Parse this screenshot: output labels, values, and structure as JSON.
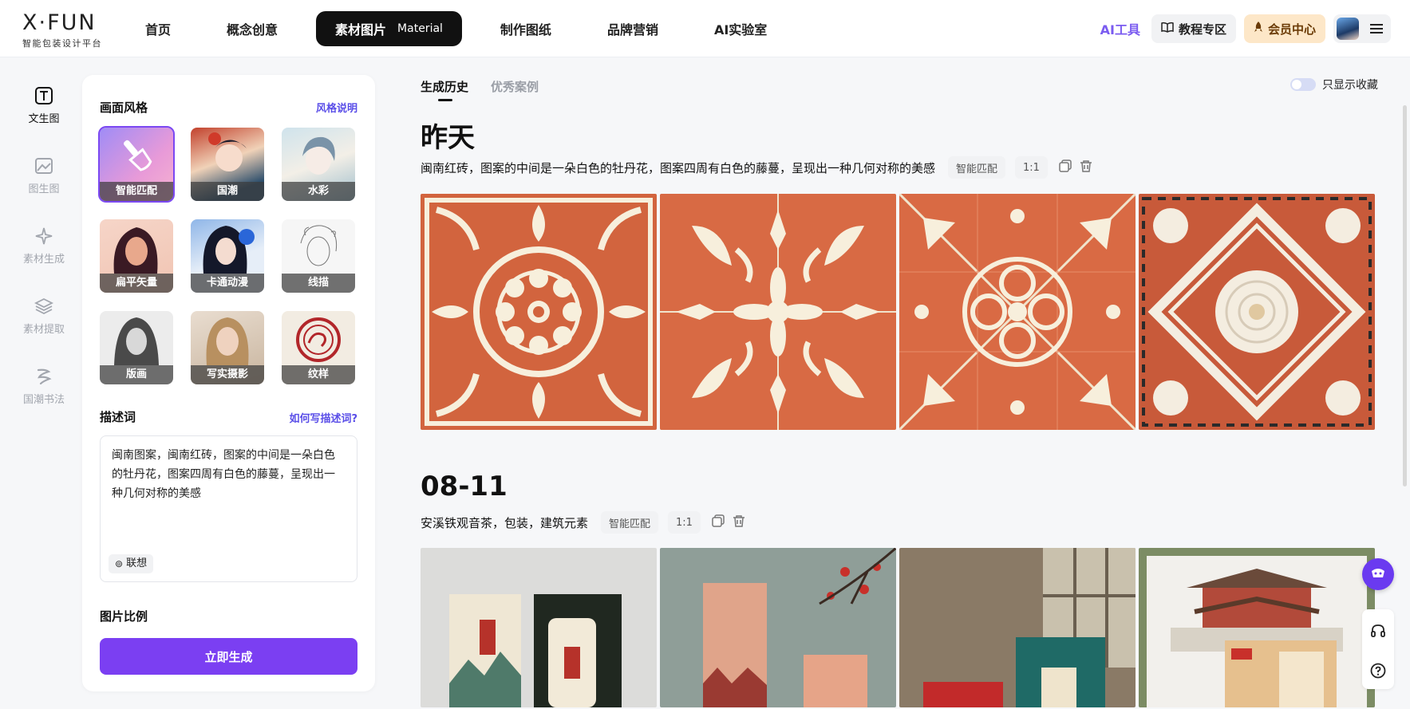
{
  "header": {
    "logo_main": "X·FUN",
    "logo_sub": "智能包装设计平台",
    "nav": [
      {
        "label": "首页"
      },
      {
        "label": "概念创意"
      },
      {
        "label": "素材图片",
        "sub": "Material"
      },
      {
        "label": "制作图纸"
      },
      {
        "label": "品牌营销"
      },
      {
        "label": "AI实验室"
      }
    ],
    "ai_tools": "AI工具",
    "tutorial": "教程专区",
    "vip": "会员中心"
  },
  "rail": [
    {
      "label": "文生图",
      "icon": "text-to-image-icon"
    },
    {
      "label": "图生图",
      "icon": "image-to-image-icon"
    },
    {
      "label": "素材生成",
      "icon": "sparkle-icon"
    },
    {
      "label": "素材提取",
      "icon": "layers-icon"
    },
    {
      "label": "国潮书法",
      "icon": "calligraphy-icon"
    }
  ],
  "panel": {
    "style_title": "画面风格",
    "style_help": "风格说明",
    "styles": [
      {
        "label": "智能匹配"
      },
      {
        "label": "国潮"
      },
      {
        "label": "水彩"
      },
      {
        "label": "扁平矢量"
      },
      {
        "label": "卡通动漫"
      },
      {
        "label": "线描"
      },
      {
        "label": "版画"
      },
      {
        "label": "写实摄影"
      },
      {
        "label": "纹样"
      }
    ],
    "prompt_title": "描述词",
    "prompt_help": "如何写描述词?",
    "prompt_text": "闽南图案，闽南红砖，图案的中间是一朵白色的牡丹花，图案四周有白色的藤蔓，呈现出一种几何对称的美感",
    "associate": "联想",
    "ratio_title": "图片比例",
    "generate": "立即生成"
  },
  "main": {
    "tabs": [
      "生成历史",
      "优秀案例"
    ],
    "favorites_only": "只显示收藏",
    "groups": [
      {
        "day": "昨天",
        "prompt": "闽南红砖，图案的中间是一朵白色的牡丹花，图案四周有白色的藤蔓，呈现出一种几何对称的美感",
        "style": "智能匹配",
        "ratio": "1:1"
      },
      {
        "day": "08-11",
        "prompt": "安溪铁观音茶，包装，建筑元素",
        "style": "智能匹配",
        "ratio": "1:1"
      }
    ]
  },
  "colors": {
    "accent": "#7b3ff2",
    "brick": "#d2643e",
    "cream": "#f7efdc"
  }
}
